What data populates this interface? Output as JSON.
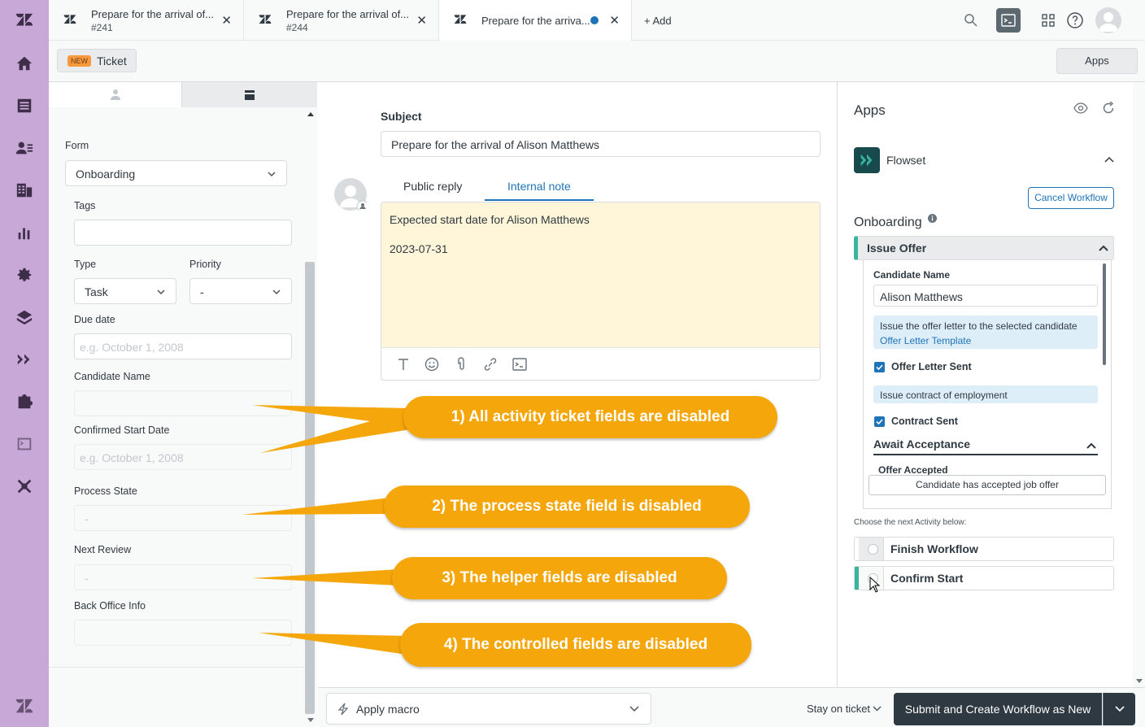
{
  "tabs": [
    {
      "title": "Prepare for the arrival of...",
      "sub": "#241"
    },
    {
      "title": "Prepare for the arrival of...",
      "sub": "#244"
    },
    {
      "title": "Prepare for the arriva...",
      "sub": ""
    }
  ],
  "add_tab": "+ Add",
  "subbar": {
    "new_badge": "NEW",
    "ticket_label": "Ticket",
    "apps_button": "Apps"
  },
  "props": {
    "form_label": "Form",
    "form_value": "Onboarding",
    "tags_label": "Tags",
    "type_label": "Type",
    "type_value": "Task",
    "priority_label": "Priority",
    "priority_value": "-",
    "due_label": "Due date",
    "due_placeholder": "e.g. October 1, 2008",
    "candidate_label": "Candidate Name",
    "start_label": "Confirmed Start Date",
    "start_placeholder": "e.g. October 1, 2008",
    "process_label": "Process State",
    "process_value": "-",
    "review_label": "Next Review",
    "review_value": "-",
    "backoffice_label": "Back Office Info"
  },
  "conversation": {
    "subject_label": "Subject",
    "subject_value": "Prepare for the arrival of Alison Matthews",
    "tab_public": "Public reply",
    "tab_internal": "Internal note",
    "note_line1": "Expected start date for Alison Matthews",
    "note_line2": "2023-07-31"
  },
  "bottom": {
    "macro": "Apply macro",
    "stay": "Stay on ticket",
    "submit": "Submit and Create Workflow as New"
  },
  "apps": {
    "title": "Apps",
    "app_name": "Flowset",
    "cancel_workflow": "Cancel Workflow",
    "workflow_title": "Onboarding",
    "issue_offer": "Issue Offer",
    "candidate_name_label": "Candidate Name",
    "candidate_name_value": "Alison Matthews",
    "offer_info": "Issue the offer letter to the selected candidate",
    "offer_link": "Offer Letter Template",
    "offer_sent": "Offer Letter Sent",
    "contract_info": "Issue contract of employment",
    "contract_sent": "Contract Sent",
    "await_acceptance": "Await Acceptance",
    "offer_accepted": "Offer Accepted",
    "candidate_accepted_btn": "Candidate has accepted job offer",
    "choose_next": "Choose the next Activity below:",
    "finish_workflow": "Finish Workflow",
    "confirm_start": "Confirm Start"
  },
  "callouts": [
    "1) All activity ticket fields are disabled",
    "2) The process state field is disabled",
    "3) The helper fields are disabled",
    "4) The controlled fields are disabled"
  ],
  "colors": {
    "nav": "#c8a8d6",
    "accent": "#1f73b7",
    "callout": "#f5a60a",
    "flowset_green": "#38b59b",
    "note_bg": "#fff6d9"
  }
}
